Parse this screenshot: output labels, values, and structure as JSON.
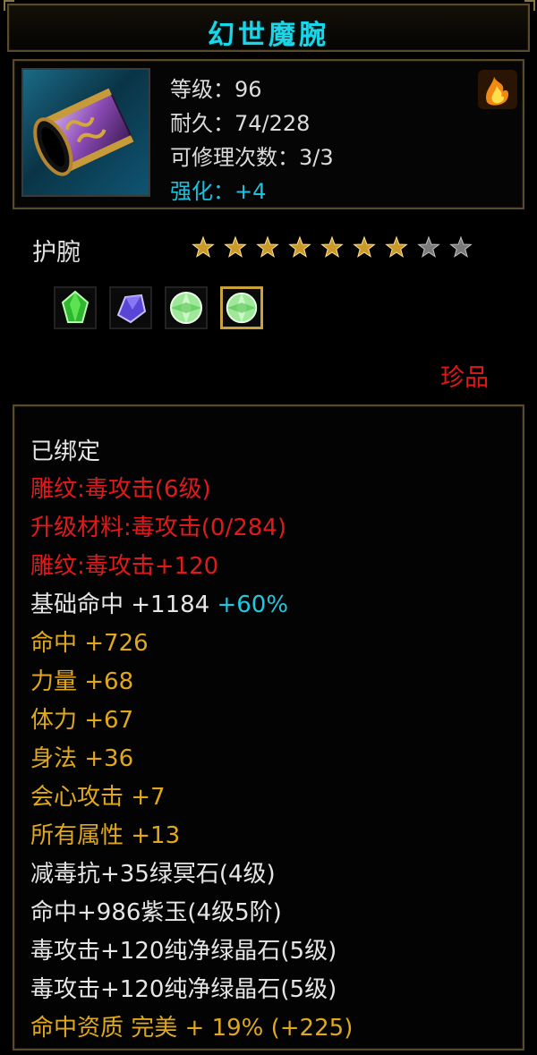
{
  "title": "幻世魔腕",
  "stats": {
    "level": "等级：96",
    "durability": "耐久：74/228",
    "repair": "可修理次数：3/3",
    "enhance": "强化：+4"
  },
  "item_type": "护腕",
  "stars": {
    "filled": 7,
    "total": 9
  },
  "gems": [
    "green-gem-icon",
    "purple-gem-icon",
    "green-crystal-icon",
    "green-crystal-icon"
  ],
  "rarity": "珍品",
  "attributes": {
    "bound": "已绑定",
    "carve1": "雕纹:毒攻击(6级)",
    "upgrade": "升级材料:毒攻击(0/284)",
    "carve2": "雕纹:毒攻击+120",
    "base_hit": "基础命中 +1184",
    "base_hit_pct": "+60%",
    "hit": "命中 +726",
    "str": "力量 +68",
    "sta": "体力 +67",
    "agi": "身法 +36",
    "crit": "会心攻击 +7",
    "all": "所有属性 +13",
    "gem1": "减毒抗+35绿冥石(4级)",
    "gem2": "命中+986紫玉(4级5阶)",
    "gem3": "毒攻击+120纯净绿晶石(5级)",
    "gem4": "毒攻击+120纯净绿晶石(5级)",
    "aptitude": "命中资质 完美 + 19% (+225)"
  },
  "colors": {
    "title": "#19d6e8",
    "gold": "#e0a81c",
    "red": "#e01a1a",
    "cyan": "#1fc7e0",
    "border": "#5a4a2c"
  }
}
